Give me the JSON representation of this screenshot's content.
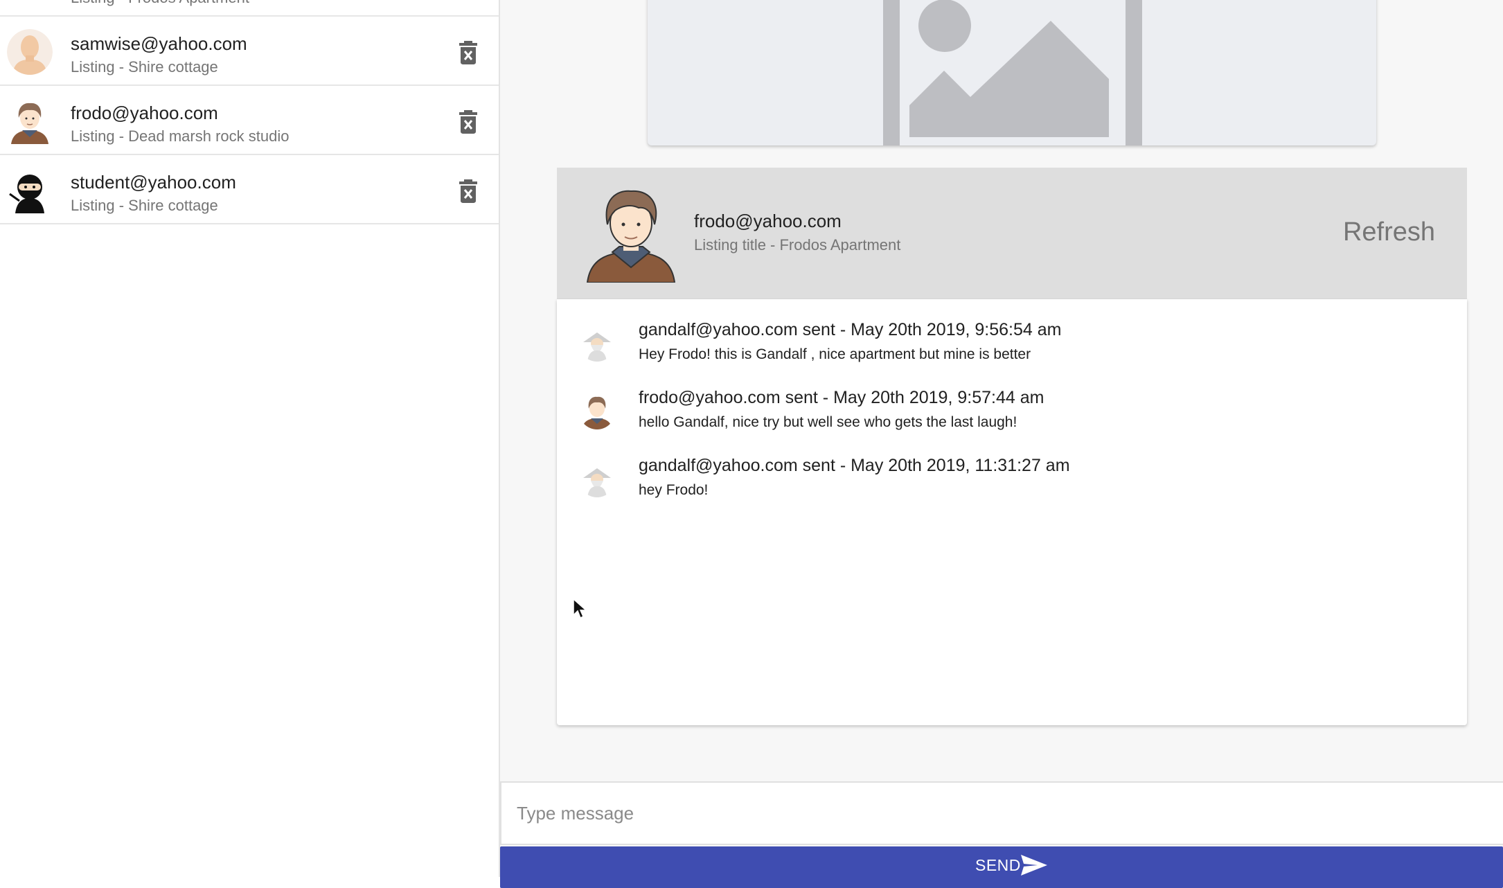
{
  "sidebar": {
    "partial_item": {
      "listing": "Listing - Frodos Apartment"
    },
    "items": [
      {
        "email": "samwise@yahoo.com",
        "listing": "Listing - Shire cottage",
        "avatar": "samwise-avatar"
      },
      {
        "email": "frodo@yahoo.com",
        "listing": "Listing - Dead marsh rock studio",
        "avatar": "frodo-avatar"
      },
      {
        "email": "student@yahoo.com",
        "listing": "Listing - Shire cottage",
        "avatar": "ninja-avatar"
      }
    ],
    "delete_icon": "delete-forever-icon"
  },
  "listing_image": {
    "icon": "image-placeholder-icon"
  },
  "chat_header": {
    "email": "frodo@yahoo.com",
    "listing": "Listing title - Frodos Apartment",
    "refresh_label": "Refresh"
  },
  "messages": [
    {
      "meta": "gandalf@yahoo.com sent - May 20th 2019, 9:56:54 am",
      "text": "Hey Frodo! this is Gandalf , nice apartment but mine is better",
      "avatar": "gandalf-avatar"
    },
    {
      "meta": "frodo@yahoo.com sent - May 20th 2019, 9:57:44 am",
      "text": "hello Gandalf, nice try but well see who gets the last laugh!",
      "avatar": "frodo-avatar"
    },
    {
      "meta": "gandalf@yahoo.com sent - May 20th 2019, 11:31:27 am",
      "text": "hey Frodo!",
      "avatar": "gandalf-avatar"
    }
  ],
  "compose": {
    "placeholder": "Type message",
    "value": ""
  },
  "send": {
    "label": "SEND",
    "icon": "send-icon"
  },
  "colors": {
    "primary": "#3f4db1",
    "header_bg": "#dedede",
    "secondary_text": "#757575"
  }
}
